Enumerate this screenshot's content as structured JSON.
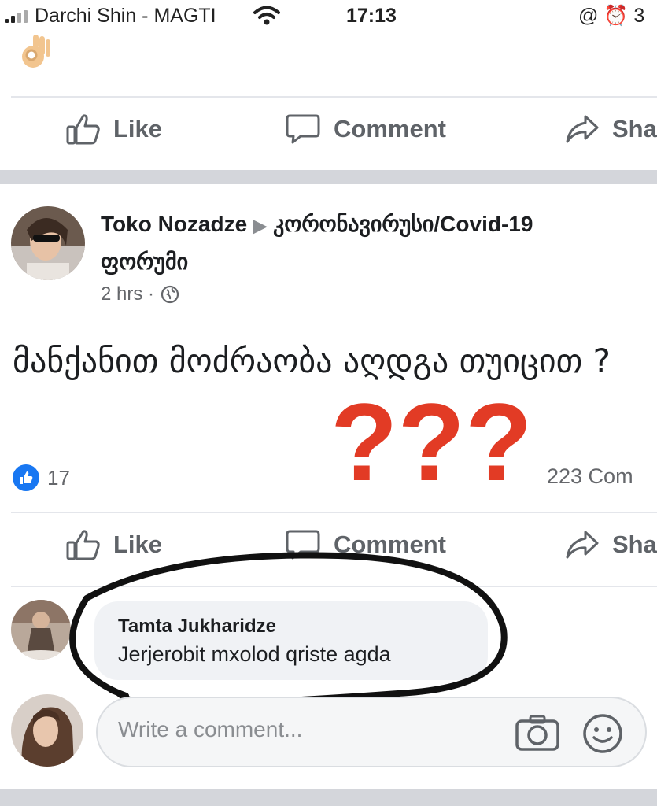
{
  "status_bar": {
    "carrier": "Darchi Shin - MAGTI",
    "time": "17:13",
    "right_text": "@ ⏰ 3"
  },
  "previous_post": {
    "emoji_icon": "ok-hand-icon",
    "actions": {
      "like": "Like",
      "comment": "Comment",
      "share": "Sha"
    }
  },
  "post": {
    "author": "Toko Nozadze",
    "group_line1": "კორონავირუსი/Covid-19",
    "group_line2": "ფორუმი",
    "time": "2 hrs ·",
    "privacy_icon": "globe-icon",
    "text": "მანქანით მოძრაობა აღდგა თუიცით ?",
    "overlay_marks": "???",
    "overlay_color": "#e23b25",
    "like_count": "17",
    "comment_count": "223 Com",
    "actions": {
      "like": "Like",
      "comment": "Comment",
      "share": "Sha"
    }
  },
  "comment": {
    "author": "Tamta Jukharidze",
    "text": "Jerjerobit mxolod qriste agda"
  },
  "composer": {
    "placeholder": "Write a comment..."
  },
  "colors": {
    "accent": "#1877f2",
    "divider": "#d4d6db"
  }
}
